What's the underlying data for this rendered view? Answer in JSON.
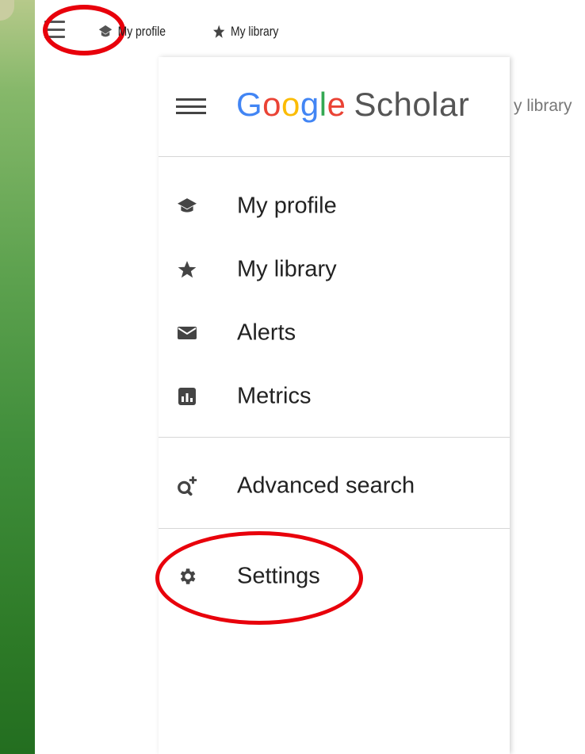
{
  "top_bar": {
    "my_profile": "My profile",
    "my_library": "My library"
  },
  "background_text": "y library",
  "drawer": {
    "logo": {
      "g1": "G",
      "o1": "o",
      "o2": "o",
      "g2": "g",
      "l": "l",
      "e": "e",
      "scholar": "Scholar"
    },
    "items": [
      {
        "label": "My profile",
        "icon": "graduation-cap-icon"
      },
      {
        "label": "My library",
        "icon": "star-icon"
      },
      {
        "label": "Alerts",
        "icon": "envelope-icon"
      },
      {
        "label": "Metrics",
        "icon": "bar-chart-icon"
      },
      {
        "label": "Advanced search",
        "icon": "search-plus-icon"
      },
      {
        "label": "Settings",
        "icon": "gear-icon"
      }
    ]
  },
  "colors": {
    "annotation": "#e8000b",
    "google_blue": "#4285f4",
    "google_red": "#ea4335",
    "google_yellow": "#fbbc05",
    "google_green": "#34a853"
  }
}
